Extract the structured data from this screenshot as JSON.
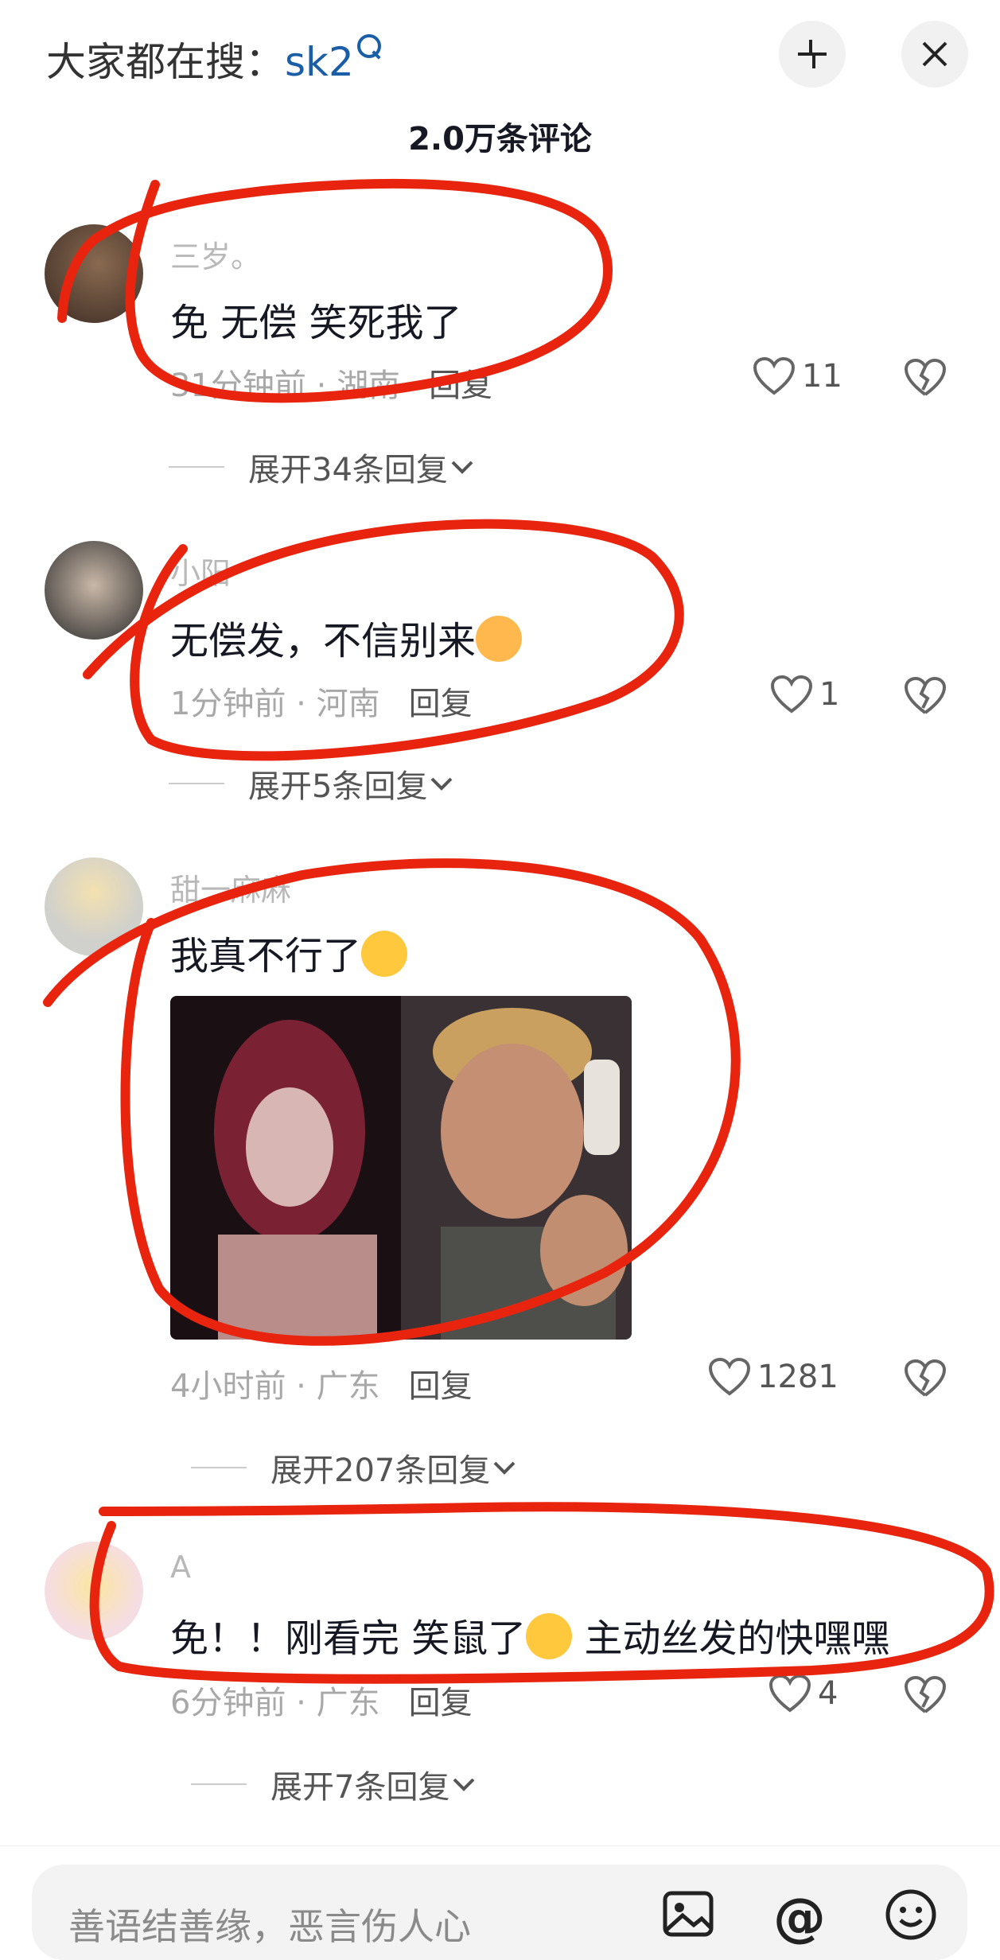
{
  "header": {
    "search_prefix": "大家都在搜：",
    "search_keyword": "sk2",
    "comment_count": "2.0万条评论"
  },
  "comments": [
    {
      "username": "三岁。",
      "text": "免 无偿 笑死我了",
      "time": "31分钟前",
      "location": "湖南",
      "reply": "回复",
      "likes": "11",
      "expand": "展开34条回复"
    },
    {
      "username": "小阳",
      "text": "无偿发，不信别来",
      "time": "1分钟前",
      "location": "河南",
      "reply": "回复",
      "likes": "1",
      "expand": "展开5条回复"
    },
    {
      "username": "甜一麻麻",
      "text": "我真不行了",
      "time": "4小时前",
      "location": "广东",
      "reply": "回复",
      "likes": "1281",
      "expand": "展开207条回复"
    },
    {
      "username": "A",
      "text": "免！！刚看完 笑鼠了",
      "text2": "主动丝发的快嘿嘿",
      "time": "6分钟前",
      "location": "广东",
      "reply": "回复",
      "likes": "4",
      "expand": "展开7条回复"
    }
  ],
  "input": {
    "placeholder": "善语结善缘，恶言伤人心"
  },
  "icons": [
    "collapse-icon",
    "close-icon",
    "heart-icon",
    "broken-heart-icon",
    "chevron-down-icon",
    "image-icon",
    "at-icon",
    "emoji-icon"
  ],
  "colors": {
    "annotation_red": "#e8240e",
    "keyword_blue": "#1a5ea8"
  }
}
